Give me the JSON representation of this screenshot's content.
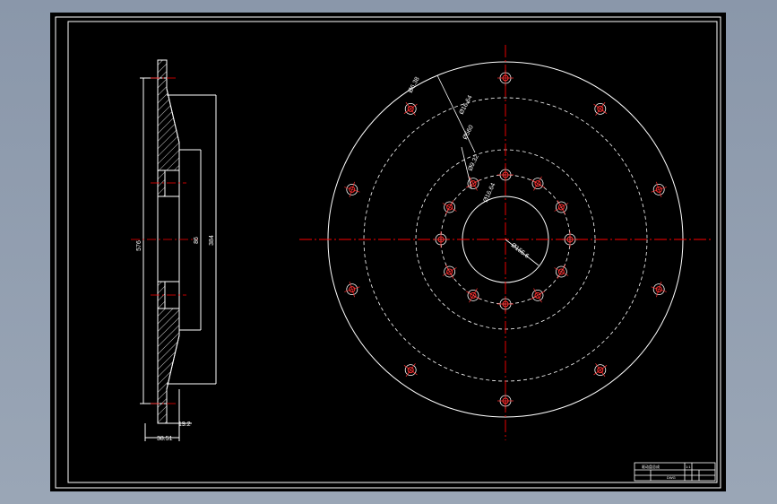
{
  "drawing": {
    "background": "#000000",
    "line_color": "#ffffff",
    "center_line_color": "#ff0000",
    "hole_color": "#ff3030",
    "section_view": {
      "dimensions": {
        "height_576": "576",
        "inner_height_1": "86",
        "inner_height_2": "384",
        "thickness_19_2": "19.2",
        "width_38_51": "38.51"
      }
    },
    "front_view": {
      "dimensions": {
        "phi_6_38": "Ø6.38",
        "phi_16_64_outer": "Ø16.64",
        "phi_560": "Ø560",
        "phi_9_32": "Ø9.32",
        "phi_16_64_inner": "Ø16.64",
        "phi_155_6": "Ø155.6"
      },
      "outer_holes": 10,
      "inner_holes": 12
    },
    "title_block": {
      "name": "驱动盘总成",
      "scale": "1:1",
      "drawing_no": "DWG"
    }
  }
}
